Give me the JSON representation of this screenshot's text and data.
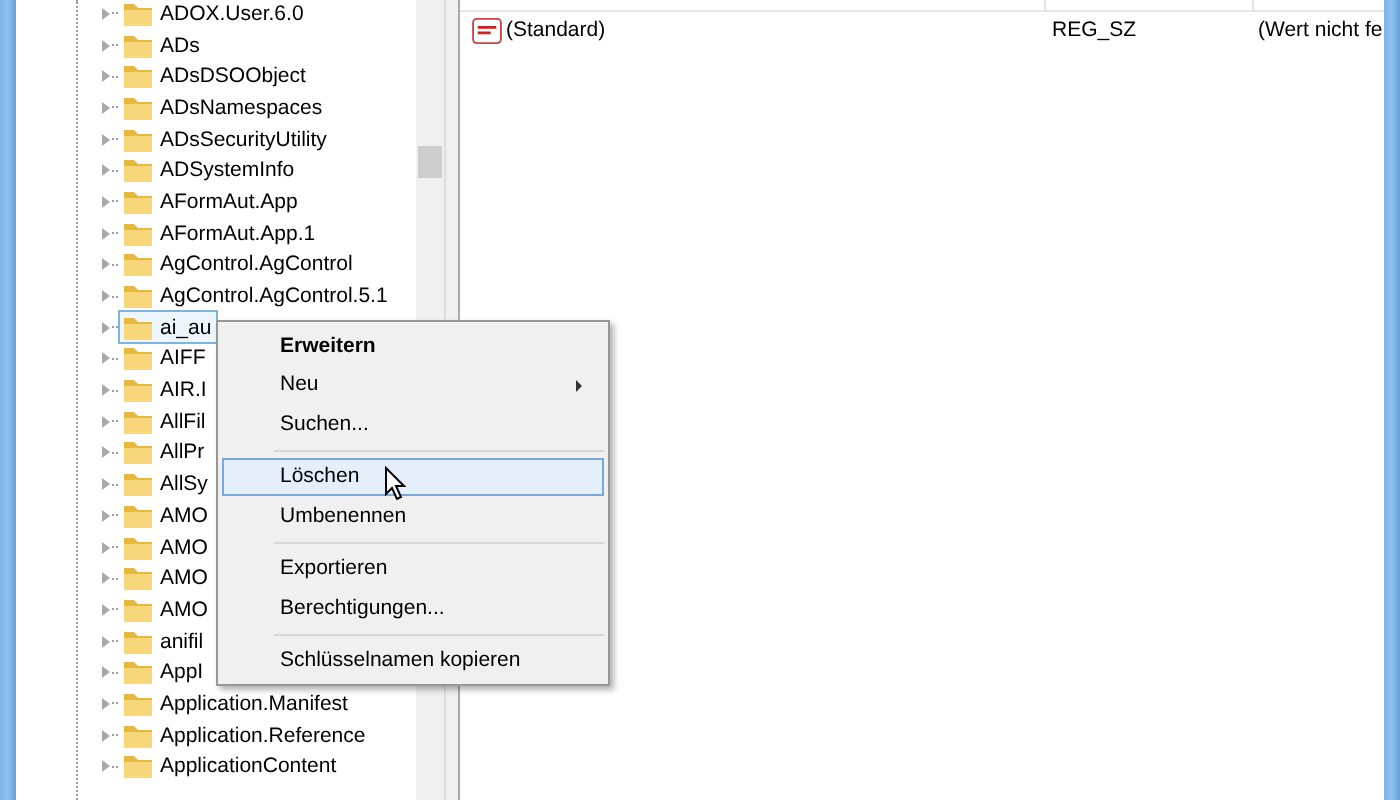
{
  "tree": {
    "items": [
      {
        "label": "ADOX.User.6.0",
        "expanded": false,
        "selected": false
      },
      {
        "label": "ADs",
        "expanded": false,
        "selected": false
      },
      {
        "label": "ADsDSOObject",
        "expanded": false,
        "selected": false
      },
      {
        "label": "ADsNamespaces",
        "expanded": false,
        "selected": false
      },
      {
        "label": "ADsSecurityUtility",
        "expanded": false,
        "selected": false
      },
      {
        "label": "ADSystemInfo",
        "expanded": false,
        "selected": false
      },
      {
        "label": "AFormAut.App",
        "expanded": false,
        "selected": false
      },
      {
        "label": "AFormAut.App.1",
        "expanded": false,
        "selected": false
      },
      {
        "label": "AgControl.AgControl",
        "expanded": false,
        "selected": false
      },
      {
        "label": "AgControl.AgControl.5.1",
        "expanded": false,
        "selected": false
      },
      {
        "label": "ai_au",
        "expanded": false,
        "selected": true
      },
      {
        "label": "AIFF",
        "expanded": false,
        "selected": false
      },
      {
        "label": "AIR.I",
        "expanded": false,
        "selected": false
      },
      {
        "label": "AllFil",
        "expanded": false,
        "selected": false
      },
      {
        "label": "AllPr",
        "expanded": false,
        "selected": false
      },
      {
        "label": "AllSy",
        "expanded": false,
        "selected": false
      },
      {
        "label": "AMO",
        "expanded": false,
        "selected": false
      },
      {
        "label": "AMO",
        "expanded": false,
        "selected": false
      },
      {
        "label": "AMO",
        "expanded": false,
        "selected": false
      },
      {
        "label": "AMO",
        "expanded": false,
        "selected": false
      },
      {
        "label": "anifil",
        "expanded": false,
        "selected": false
      },
      {
        "label": "AppI",
        "expanded": false,
        "selected": false
      },
      {
        "label": "Application.Manifest",
        "expanded": false,
        "selected": false
      },
      {
        "label": "Application.Reference",
        "expanded": false,
        "selected": false
      },
      {
        "label": "ApplicationContent",
        "expanded": false,
        "selected": false
      }
    ]
  },
  "values": {
    "rows": [
      {
        "name": "(Standard)",
        "type": "REG_SZ",
        "data": "(Wert nicht fe"
      }
    ]
  },
  "context_menu": {
    "items": [
      {
        "kind": "item",
        "label": "Erweitern",
        "default": true,
        "submenu": false,
        "selected": false
      },
      {
        "kind": "item",
        "label": "Neu",
        "default": false,
        "submenu": true,
        "selected": false
      },
      {
        "kind": "item",
        "label": "Suchen...",
        "default": false,
        "submenu": false,
        "selected": false
      },
      {
        "kind": "separator"
      },
      {
        "kind": "item",
        "label": "Löschen",
        "default": false,
        "submenu": false,
        "selected": true
      },
      {
        "kind": "item",
        "label": "Umbenennen",
        "default": false,
        "submenu": false,
        "selected": false
      },
      {
        "kind": "separator"
      },
      {
        "kind": "item",
        "label": "Exportieren",
        "default": false,
        "submenu": false,
        "selected": false
      },
      {
        "kind": "item",
        "label": "Berechtigungen...",
        "default": false,
        "submenu": false,
        "selected": false
      },
      {
        "kind": "separator"
      },
      {
        "kind": "item",
        "label": "Schlüsselnamen kopieren",
        "default": false,
        "submenu": false,
        "selected": false
      }
    ]
  }
}
